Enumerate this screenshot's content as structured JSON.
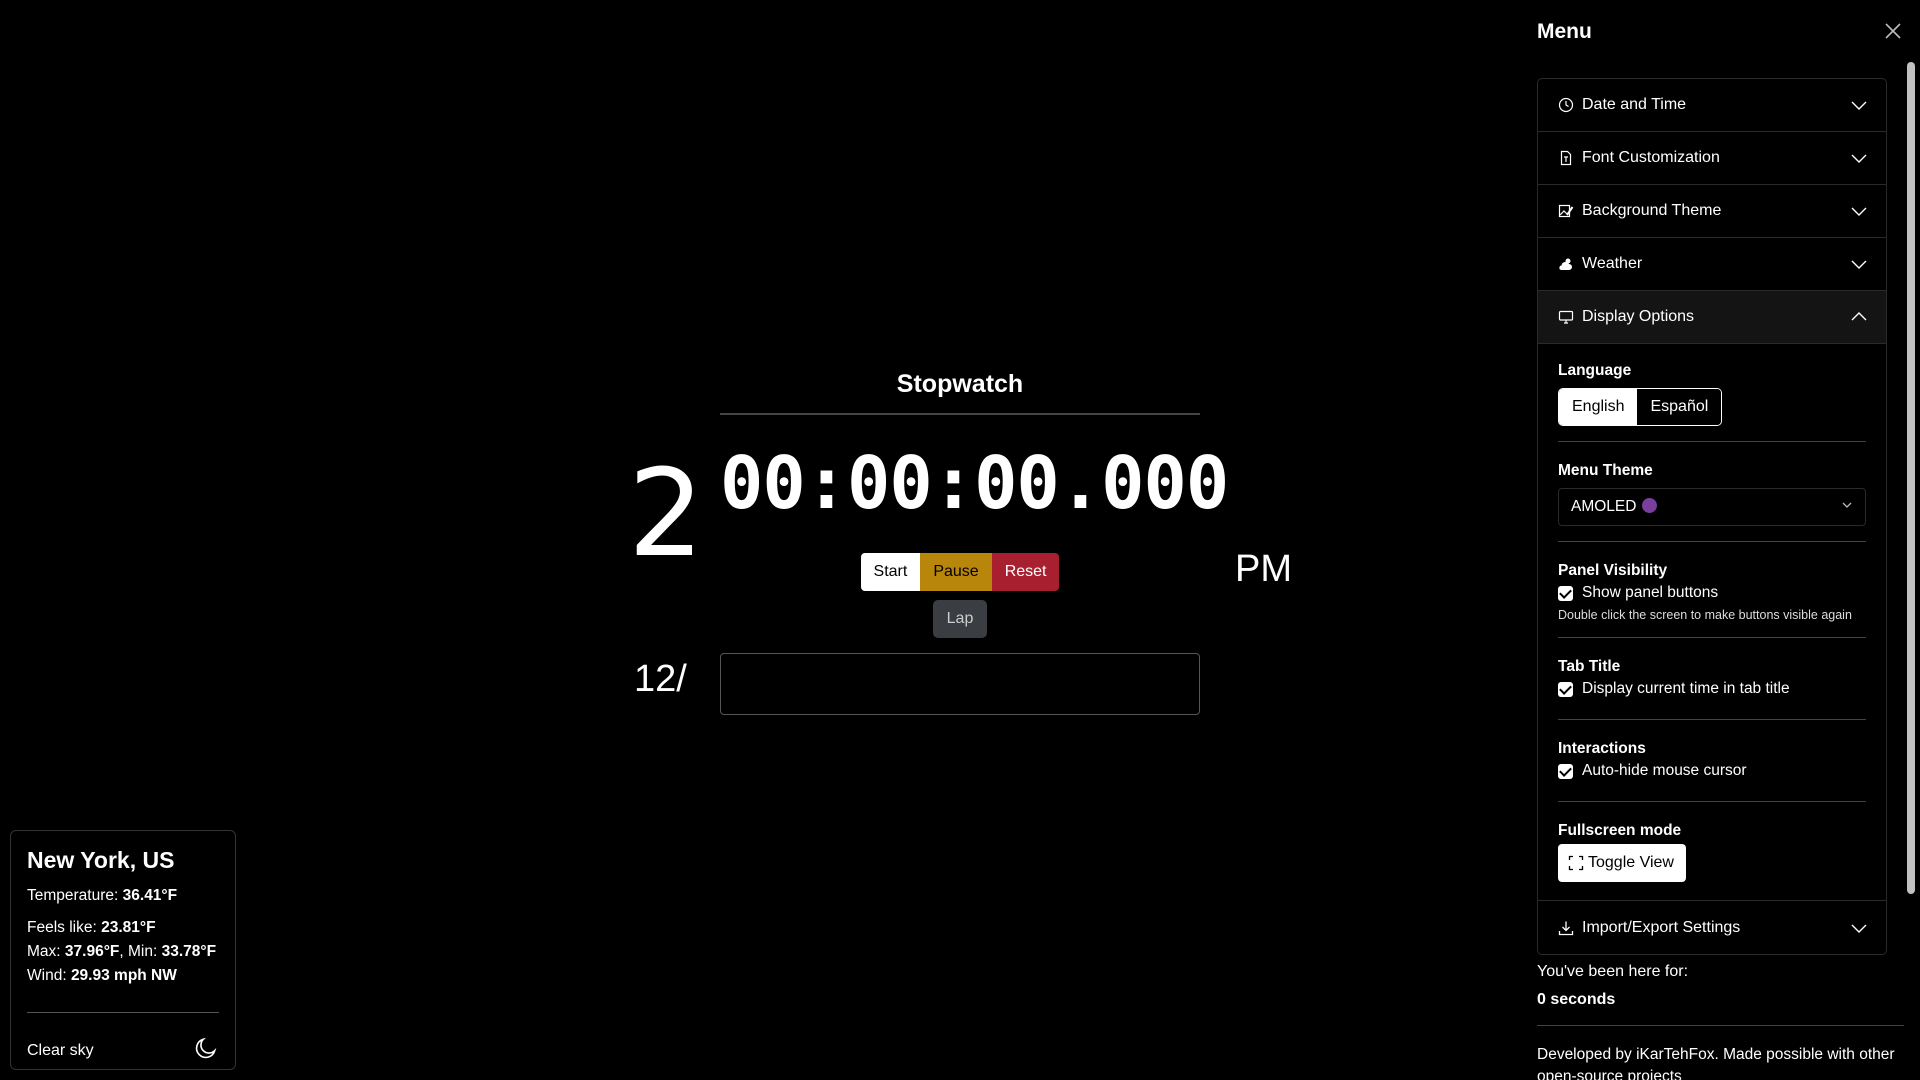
{
  "clock": {
    "digit_partial": "2",
    "date": "12/",
    "ampm": "PM"
  },
  "stopwatch": {
    "title": "Stopwatch",
    "time": "00:00:00.000",
    "start_label": "Start",
    "pause_label": "Pause",
    "reset_label": "Reset",
    "lap_label": "Lap",
    "colors": {
      "start": "#ffffff",
      "pause": "#b8860b",
      "reset": "#a8202f",
      "lap": "#3a3d42"
    }
  },
  "weather": {
    "city": "New York, US",
    "temperature_label": "Temperature: ",
    "temperature": "36.41°F",
    "feels_like_label": "Feels like: ",
    "feels_like": "23.81°F",
    "max_label": "Max: ",
    "max": "37.96°F",
    "min_label": ", Min: ",
    "min": "33.78°F",
    "wind_label": "Wind: ",
    "wind": "29.93 mph NW",
    "description": "Clear sky",
    "icon": "moon-icon"
  },
  "menu": {
    "title": "Menu",
    "sections": {
      "date_time": "Date and Time",
      "font": "Font Customization",
      "background": "Background Theme",
      "weather": "Weather",
      "display": "Display Options",
      "import_export": "Import/Export Settings"
    },
    "display": {
      "language_label": "Language",
      "lang_en": "English",
      "lang_es": "Español",
      "menu_theme_label": "Menu Theme",
      "menu_theme_value": "AMOLED",
      "theme_dot_color": "#7a3f9e",
      "panel_visibility_label": "Panel Visibility",
      "show_panel_buttons": "Show panel buttons",
      "panel_hint": "Double click the screen to make buttons visible again",
      "tab_title_label": "Tab Title",
      "display_time_in_tab": "Display current time in tab title",
      "interactions_label": "Interactions",
      "auto_hide_cursor": "Auto-hide mouse cursor",
      "fullscreen_label": "Fullscreen mode",
      "toggle_view": "Toggle View"
    },
    "here_for_label": "You've been here for:",
    "here_for_value": "0 seconds",
    "developer_note": "Developed by iKarTehFox. Made possible with other open-source projects"
  }
}
